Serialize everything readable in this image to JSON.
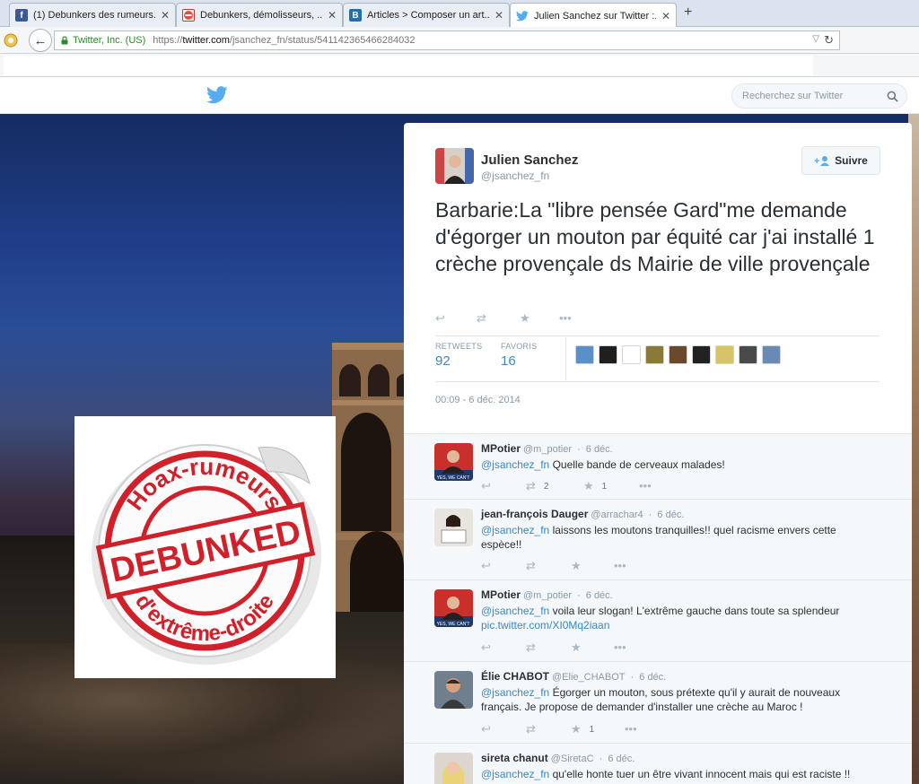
{
  "browser": {
    "tabs": [
      {
        "label": "(1) Debunkers des rumeurs...",
        "icon": "facebook-icon",
        "color": "#3b5998"
      },
      {
        "label": "Debunkers, démolisseurs, ...",
        "icon": "no-entry-icon",
        "color": "#c0392b"
      },
      {
        "label": "Articles > Composer un art...",
        "icon": "blogger-b-icon",
        "color": "#1f6fb2"
      },
      {
        "label": "Julien Sanchez sur Twitter :...",
        "icon": "twitter-bird-icon",
        "color": "#55acee"
      }
    ],
    "new_tab_label": "+",
    "site_identity": "Twitter, Inc. (US)",
    "url_scheme": "https://",
    "url_host": "twitter.com",
    "url_path": "/jsanchez_fn/status/541142365466284032"
  },
  "header": {
    "search_placeholder": "Recherchez sur Twitter"
  },
  "scene": {
    "image_text_top": "Hoax-rumeurs",
    "image_text_middle": "DEBUNKED",
    "image_text_bottom": "d'extrême-droite"
  },
  "tweet": {
    "author_name": "Julien Sanchez",
    "author_handle": "@jsanchez_fn",
    "follow_label": "Suivre",
    "text": "Barbarie:La \"libre pensée Gard\"me demande d'égorger un mouton par équité car j'ai installé 1 crèche provençale ds Mairie de ville provençale",
    "retweets_label": "RETWEETS",
    "retweets_count": "92",
    "favorites_label": "FAVORIS",
    "favorites_count": "16",
    "favorited_by": [
      "#5b8fc7",
      "#1f1f1f",
      "#ffffff",
      "#8a7a3a",
      "#6a4a2a",
      "#222222",
      "#d8c26a",
      "#4a4a4a",
      "#6a8ab5"
    ],
    "timestamp": "00:09 - 6 déc. 2014"
  },
  "replies": [
    {
      "name": "MPotier",
      "handle": "@m_potier",
      "date": "6 déc.",
      "mention": "@jsanchez_fn",
      "text": "Quelle bande de cerveaux malades!",
      "link": "",
      "retweets": "2",
      "favorites": "1",
      "avatar_caption": "YES, WE CAN'T"
    },
    {
      "name": "jean-françois Dauger",
      "handle": "@arrachar4",
      "date": "6 déc.",
      "mention": "@jsanchez_fn",
      "text": "laissons les moutons tranquilles!! quel racisme envers cette espèce!!",
      "link": "",
      "retweets": "",
      "favorites": "",
      "avatar_caption": ""
    },
    {
      "name": "MPotier",
      "handle": "@m_potier",
      "date": "6 déc.",
      "mention": "@jsanchez_fn",
      "text": "voila leur slogan! L'extrême gauche dans toute sa splendeur",
      "link": "pic.twitter.com/XI0Mq2iaan",
      "retweets": "",
      "favorites": "",
      "avatar_caption": "YES, WE CAN'T"
    },
    {
      "name": "Élie CHABOT",
      "handle": "@Elie_CHABOT",
      "date": "6 déc.",
      "mention": "@jsanchez_fn",
      "text": "Égorger un mouton, sous prétexte qu'il y aurait de nouveaux français. Je propose de demander d'installer une crèche au Maroc !",
      "link": "",
      "retweets": "",
      "favorites": "1",
      "avatar_caption": ""
    },
    {
      "name": "sireta chanut",
      "handle": "@SiretaC",
      "date": "6 déc.",
      "mention": "@jsanchez_fn",
      "text": "qu'elle honte tuer un être vivant innocent mais qui est raciste !!",
      "link": "",
      "retweets": "",
      "favorites": "",
      "avatar_caption": ""
    }
  ],
  "colors": {
    "twitter_blue": "#55acee",
    "link_blue": "#3b88c3",
    "stamp_red": "#d0202a"
  }
}
